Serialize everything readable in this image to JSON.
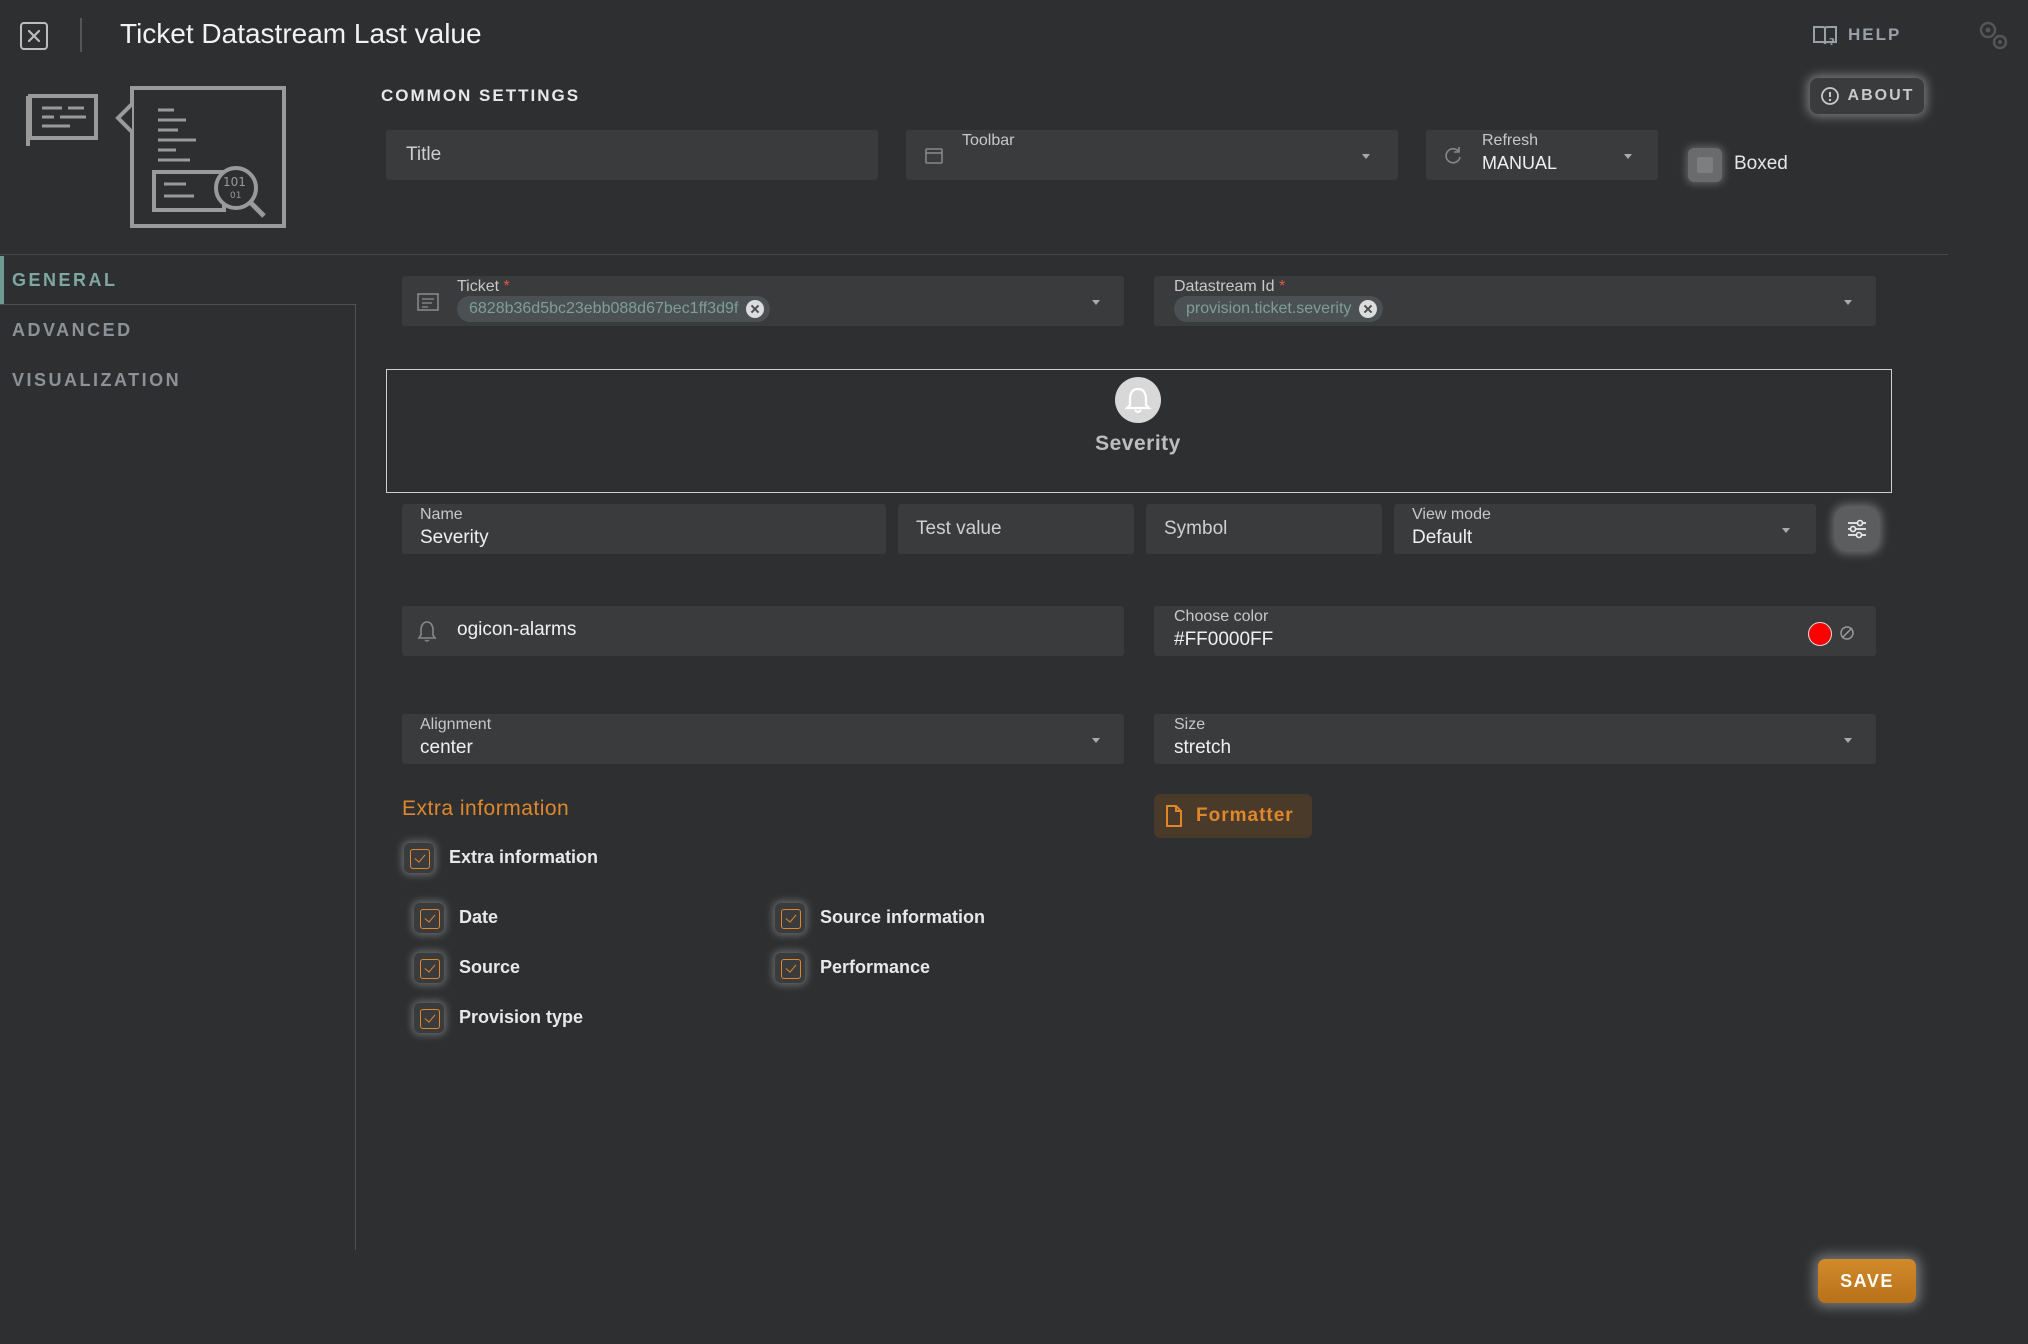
{
  "header": {
    "title": "Ticket Datastream Last value",
    "help_label": "HELP",
    "about_label": "ABOUT"
  },
  "common": {
    "section_title": "COMMON SETTINGS",
    "title_placeholder": "Title",
    "toolbar_label": "Toolbar",
    "refresh_label": "Refresh",
    "refresh_value": "MANUAL",
    "boxed_label": "Boxed"
  },
  "sidebar": {
    "items": [
      {
        "label": "GENERAL",
        "active": true
      },
      {
        "label": "ADVANCED",
        "active": false
      },
      {
        "label": "VISUALIZATION",
        "active": false
      }
    ]
  },
  "general": {
    "ticket_label": "Ticket",
    "ticket_chip": "6828b36d5bc23ebb088d67bec1ff3d9f",
    "datastream_label": "Datastream Id",
    "datastream_chip": "provision.ticket.severity",
    "required_mark": "*",
    "preview_label": "Severity",
    "name_label": "Name",
    "name_value": "Severity",
    "test_value_placeholder": "Test value",
    "symbol_placeholder": "Symbol",
    "view_mode_label": "View mode",
    "view_mode_value": "Default",
    "icon_value": "ogicon-alarms",
    "color_label": "Choose color",
    "color_value": "#FF0000FF",
    "alignment_label": "Alignment",
    "alignment_value": "center",
    "size_label": "Size",
    "size_value": "stretch",
    "extra_title": "Extra information",
    "formatter_label": "Formatter",
    "extra_checkbox_label": "Extra information",
    "options": {
      "date": "Date",
      "source": "Source",
      "provision_type": "Provision type",
      "source_information": "Source information",
      "performance": "Performance"
    },
    "save_label": "SAVE"
  },
  "colors": {
    "accent": "#E0872D",
    "active_tab": "#7FA8A0",
    "background": "#2E2F31",
    "field": "#3A3B3D",
    "selected_color": "#FF0000"
  }
}
